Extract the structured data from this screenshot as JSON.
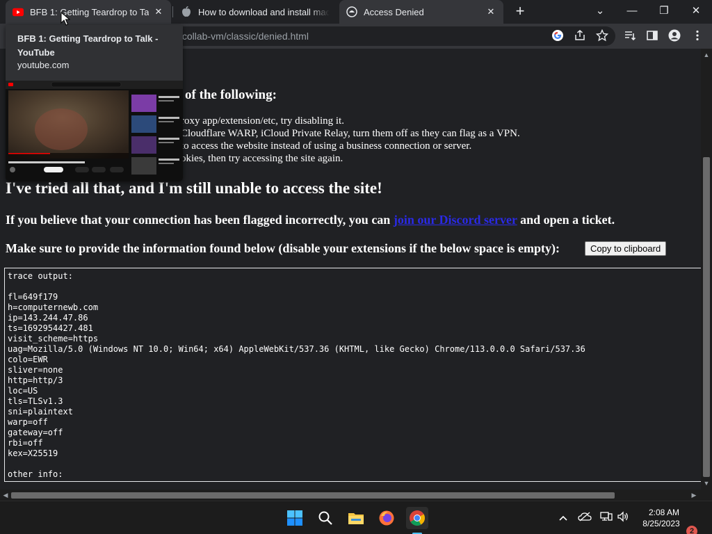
{
  "colors": {
    "accent_red": "#ff0000",
    "link": "#2a2ae6",
    "chrome_active_tab": "#35363a",
    "page_bg": "#202124"
  },
  "tabs": [
    {
      "title": "BFB 1: Getting Teardrop to Talk - YouTube",
      "icon": "youtube-icon",
      "close": "✕"
    },
    {
      "title": "How to download and install macOS",
      "icon": "apple-icon",
      "close": "✕"
    },
    {
      "title": "Access Denied",
      "icon": "cloudflare-icon",
      "close": "✕"
    }
  ],
  "new_tab_label": "+",
  "window_controls": {
    "tab_search": "⌄",
    "minimize": "—",
    "restore": "❐",
    "close": "✕"
  },
  "toolbar": {
    "url": "/collab-vm/classic/denied.html",
    "icons": [
      "google-lens-icon",
      "share-icon",
      "bookmark-star-icon",
      "reading-list-icon",
      "side-panel-icon",
      "profile-icon",
      "menu-icon"
    ]
  },
  "hover_card": {
    "title": "BFB 1: Getting Teardrop to Talk - YouTube",
    "domain": "youtube.com",
    "preview": {
      "logo": "YouTube",
      "video_title": "BFB 1: Getting Teardrop to Talk",
      "subscribe": "Subscribe",
      "caption": "wow lose meals bud i guess whats good at"
    }
  },
  "page": {
    "heading_fragment": "of the following:",
    "tips": [
      "roxy app/extension/etc, try disabling it.",
      "Cloudflare WARP, iCloud Private Relay, turn them off as they can flag as a VPN.",
      "to access the website instead of using a business connection or server.",
      "okies, then try accessing the site again."
    ],
    "tried_heading": "I've tried all that, and I'm still unable to access the site!",
    "ticket_prefix": "If you believe that your connection has been flagged incorrectly, you can ",
    "ticket_link": "join our Discord server",
    "ticket_suffix": " and open a ticket.",
    "provide_text": "Make sure to provide the information found below (disable your extensions if the below space is empty):",
    "copy_button": "Copy to clipboard",
    "trace_lines": [
      "trace output:",
      "",
      "fl=649f179",
      "h=computernewb.com",
      "ip=143.244.47.86",
      "ts=1692954427.481",
      "visit_scheme=https",
      "uag=Mozilla/5.0 (Windows NT 10.0; Win64; x64) AppleWebKit/537.36 (KHTML, like Gecko) Chrome/113.0.0.0 Safari/537.36",
      "colo=EWR",
      "sliver=none",
      "http=http/3",
      "loc=US",
      "tls=TLSv1.3",
      "sni=plaintext",
      "warp=off",
      "gateway=off",
      "rbi=off",
      "kex=X25519",
      "",
      "other info:"
    ]
  },
  "taskbar": {
    "apps": [
      "windows-start-icon",
      "search-icon",
      "file-explorer-icon",
      "firefox-icon",
      "chrome-icon"
    ],
    "tray": [
      "chevron-up-icon",
      "onedrive-icon",
      "network-icon",
      "volume-icon"
    ],
    "time": "2:08 AM",
    "date": "8/25/2023",
    "notifications": "2"
  }
}
